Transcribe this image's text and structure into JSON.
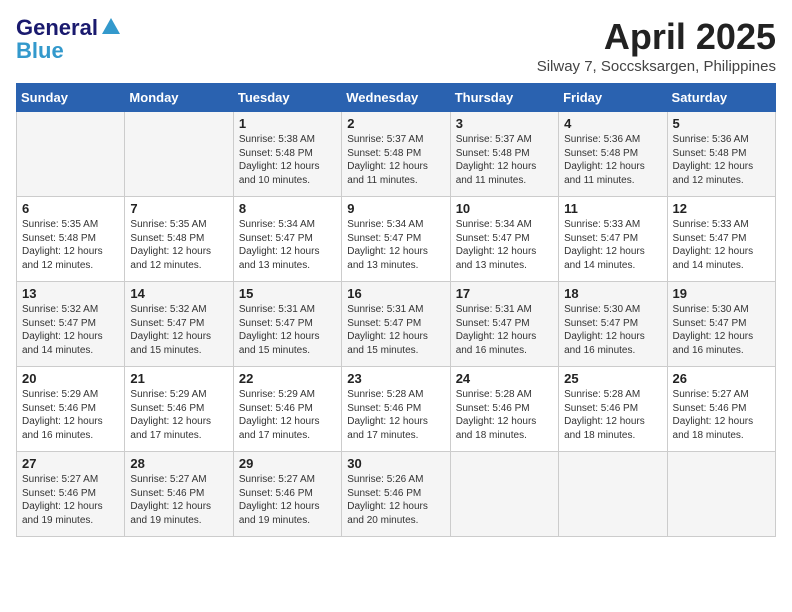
{
  "header": {
    "logo_general": "General",
    "logo_blue": "Blue",
    "month_title": "April 2025",
    "location": "Silway 7, Soccsksargen, Philippines"
  },
  "days_of_week": [
    "Sunday",
    "Monday",
    "Tuesday",
    "Wednesday",
    "Thursday",
    "Friday",
    "Saturday"
  ],
  "weeks": [
    [
      {
        "day": "",
        "info": ""
      },
      {
        "day": "",
        "info": ""
      },
      {
        "day": "1",
        "info": "Sunrise: 5:38 AM\nSunset: 5:48 PM\nDaylight: 12 hours and 10 minutes."
      },
      {
        "day": "2",
        "info": "Sunrise: 5:37 AM\nSunset: 5:48 PM\nDaylight: 12 hours and 11 minutes."
      },
      {
        "day": "3",
        "info": "Sunrise: 5:37 AM\nSunset: 5:48 PM\nDaylight: 12 hours and 11 minutes."
      },
      {
        "day": "4",
        "info": "Sunrise: 5:36 AM\nSunset: 5:48 PM\nDaylight: 12 hours and 11 minutes."
      },
      {
        "day": "5",
        "info": "Sunrise: 5:36 AM\nSunset: 5:48 PM\nDaylight: 12 hours and 12 minutes."
      }
    ],
    [
      {
        "day": "6",
        "info": "Sunrise: 5:35 AM\nSunset: 5:48 PM\nDaylight: 12 hours and 12 minutes."
      },
      {
        "day": "7",
        "info": "Sunrise: 5:35 AM\nSunset: 5:48 PM\nDaylight: 12 hours and 12 minutes."
      },
      {
        "day": "8",
        "info": "Sunrise: 5:34 AM\nSunset: 5:47 PM\nDaylight: 12 hours and 13 minutes."
      },
      {
        "day": "9",
        "info": "Sunrise: 5:34 AM\nSunset: 5:47 PM\nDaylight: 12 hours and 13 minutes."
      },
      {
        "day": "10",
        "info": "Sunrise: 5:34 AM\nSunset: 5:47 PM\nDaylight: 12 hours and 13 minutes."
      },
      {
        "day": "11",
        "info": "Sunrise: 5:33 AM\nSunset: 5:47 PM\nDaylight: 12 hours and 14 minutes."
      },
      {
        "day": "12",
        "info": "Sunrise: 5:33 AM\nSunset: 5:47 PM\nDaylight: 12 hours and 14 minutes."
      }
    ],
    [
      {
        "day": "13",
        "info": "Sunrise: 5:32 AM\nSunset: 5:47 PM\nDaylight: 12 hours and 14 minutes."
      },
      {
        "day": "14",
        "info": "Sunrise: 5:32 AM\nSunset: 5:47 PM\nDaylight: 12 hours and 15 minutes."
      },
      {
        "day": "15",
        "info": "Sunrise: 5:31 AM\nSunset: 5:47 PM\nDaylight: 12 hours and 15 minutes."
      },
      {
        "day": "16",
        "info": "Sunrise: 5:31 AM\nSunset: 5:47 PM\nDaylight: 12 hours and 15 minutes."
      },
      {
        "day": "17",
        "info": "Sunrise: 5:31 AM\nSunset: 5:47 PM\nDaylight: 12 hours and 16 minutes."
      },
      {
        "day": "18",
        "info": "Sunrise: 5:30 AM\nSunset: 5:47 PM\nDaylight: 12 hours and 16 minutes."
      },
      {
        "day": "19",
        "info": "Sunrise: 5:30 AM\nSunset: 5:47 PM\nDaylight: 12 hours and 16 minutes."
      }
    ],
    [
      {
        "day": "20",
        "info": "Sunrise: 5:29 AM\nSunset: 5:46 PM\nDaylight: 12 hours and 16 minutes."
      },
      {
        "day": "21",
        "info": "Sunrise: 5:29 AM\nSunset: 5:46 PM\nDaylight: 12 hours and 17 minutes."
      },
      {
        "day": "22",
        "info": "Sunrise: 5:29 AM\nSunset: 5:46 PM\nDaylight: 12 hours and 17 minutes."
      },
      {
        "day": "23",
        "info": "Sunrise: 5:28 AM\nSunset: 5:46 PM\nDaylight: 12 hours and 17 minutes."
      },
      {
        "day": "24",
        "info": "Sunrise: 5:28 AM\nSunset: 5:46 PM\nDaylight: 12 hours and 18 minutes."
      },
      {
        "day": "25",
        "info": "Sunrise: 5:28 AM\nSunset: 5:46 PM\nDaylight: 12 hours and 18 minutes."
      },
      {
        "day": "26",
        "info": "Sunrise: 5:27 AM\nSunset: 5:46 PM\nDaylight: 12 hours and 18 minutes."
      }
    ],
    [
      {
        "day": "27",
        "info": "Sunrise: 5:27 AM\nSunset: 5:46 PM\nDaylight: 12 hours and 19 minutes."
      },
      {
        "day": "28",
        "info": "Sunrise: 5:27 AM\nSunset: 5:46 PM\nDaylight: 12 hours and 19 minutes."
      },
      {
        "day": "29",
        "info": "Sunrise: 5:27 AM\nSunset: 5:46 PM\nDaylight: 12 hours and 19 minutes."
      },
      {
        "day": "30",
        "info": "Sunrise: 5:26 AM\nSunset: 5:46 PM\nDaylight: 12 hours and 20 minutes."
      },
      {
        "day": "",
        "info": ""
      },
      {
        "day": "",
        "info": ""
      },
      {
        "day": "",
        "info": ""
      }
    ]
  ]
}
